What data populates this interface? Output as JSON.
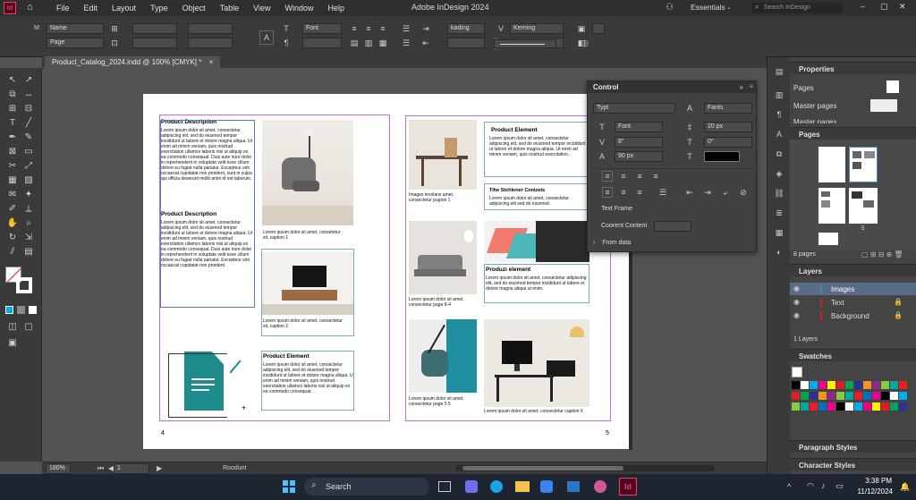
{
  "app": {
    "title": "Adobe InDesign 2024",
    "icon_text": "Id",
    "workspace": "Essentials",
    "search_placeholder": "Search InDesign"
  },
  "menu": [
    "File",
    "Edit",
    "Layout",
    "Type",
    "Object",
    "Table",
    "View",
    "Window",
    "Help"
  ],
  "control_bar": {
    "name_label": "M:",
    "name_value": "Name",
    "page_value": "Page",
    "font_value": "Font",
    "kading_value": "kading",
    "kerning_value": "Kerning"
  },
  "document_tab": {
    "label": "Product_Catalog_2024.indd @ 100% [CMYK] *",
    "close": "×"
  },
  "left_page": {
    "heading1": "Product Description",
    "body1": "Lorem ipsum dolor sit amet, consectetur adipiscing elit, sed do eiusmod tempor incididunt ut labore et dolore magna aliqua. Ut enim ad minim veniam, quis nostrud exercitation ullamco laboris nisi ut aliquip ex ea commodo consequat. Duis aute irure dolor in reprehenderit in voluptate velit esse cillum dolore eu fugiat nulla pariatur. Excepteur sint occaecat cupidatat non proident, sunt in culpa qui officia deserunt mollit anim id est laborum.",
    "heading2": "Product Description",
    "body2": "Lorem ipsum dolor sit amet, consectetur adipiscing elit, sed do eiusmod tempor incididunt ut labore et dolore magna aliqua. Ut enim ad minim veniam, quis nostrud exercitation ullamco laboris nisi ut aliquip ex ea commodo consequat. Duis aute irure dolor in reprehenderit in voluptate velit esse cillum dolore eu fugiat nulla pariatur. Excepteur sint occaecat cupidatat non proident.",
    "cap1": "Lorem ipsum dolor sit amet, consetetur sit, caption 1",
    "cap2": "Lorem ipsum dolor sit amet, consectetur sit, caption 2",
    "heading3": "Product Element",
    "body3": "Lorem ipsum dolor sit amet, consectetur adipiscing elit, sed do eiusmod tempor incididunt ut labore et dolore magna aliqua. Ut enim ad minim veniam, quis nostrud exercitation ullamco laboris nisi ut aliquip ex ea commodo consequat.",
    "page_number": "4"
  },
  "right_page": {
    "cap_a": "Images tevolans amet, consectetur pugion 1",
    "heading_a": "Product Element",
    "body_a": "Lorem ipsum dolor sit amet, consectetur adipiscing elit, sed do eiusmod tempor incididunt ut labore et dolore magna aliqua. Ut enim ad minim veniam, quis nostrud exercitation.",
    "heading_b": "Tihe Stchlener Conizets",
    "body_b": "Lorem ipsum dolor sit amet, consectetur adipiscing elit sed do eiusmod.",
    "cap_c": "Lorem ipsum dolor sit amet, consectetur page 8-4",
    "heading_d": "Produzi element",
    "body_d": "Lorem ipsum dolor sit amet, consectetur adipiscing elit, sed do eiusmod tempor incididunt ut labore et dolore magna aliqua ut enim.",
    "cap_e": "Lorem ipsum dolor sit amet, consectetur page 5 5",
    "cap_f": "Lorem ipsum dolor sit amet, consectetur caption 6",
    "page_number": "5"
  },
  "control_panel": {
    "title": "Control",
    "type_value": "Typt",
    "fants_value": "Fants",
    "font_value": "Font",
    "size1": "20 px",
    "size2": "8\"",
    "deg": "0°",
    "size3": "90 px",
    "text_frame": "Text Frame",
    "content_label": "Coorent Content",
    "from_data": "From data"
  },
  "properties": {
    "title": "Properties",
    "pages": "Pages",
    "master_pages": "Master pages",
    "master_pages2": "Master pages"
  },
  "pages_panel": {
    "title": "Pages",
    "count": "8 pages",
    "thumb_label": "5"
  },
  "layers_panel": {
    "title": "Layers",
    "layers": [
      "Images",
      "Text",
      "Background"
    ],
    "count": "1 Layers"
  },
  "swatches_panel": {
    "title": "Swatches"
  },
  "paragraph_styles": "Paragraph Styles",
  "character_styles": "Character Styles",
  "status": {
    "zoom": "180%",
    "page": "1",
    "status_text": "Roodunt"
  },
  "taskbar": {
    "search": "Search",
    "time": "3:38 PM",
    "date": "11/12/2024"
  },
  "colors": {
    "accent": "#ff3366",
    "selection": "#4a7fc1",
    "swatches": [
      "#000000",
      "#ffffff",
      "#00aeef",
      "#ec008c",
      "#fff200",
      "#e31b23",
      "#00a651",
      "#2e3192",
      "#f7941d",
      "#92278f",
      "#8dc63f",
      "#00a99d",
      "#ed1c24",
      "#0072bc",
      "#ec008c"
    ]
  }
}
